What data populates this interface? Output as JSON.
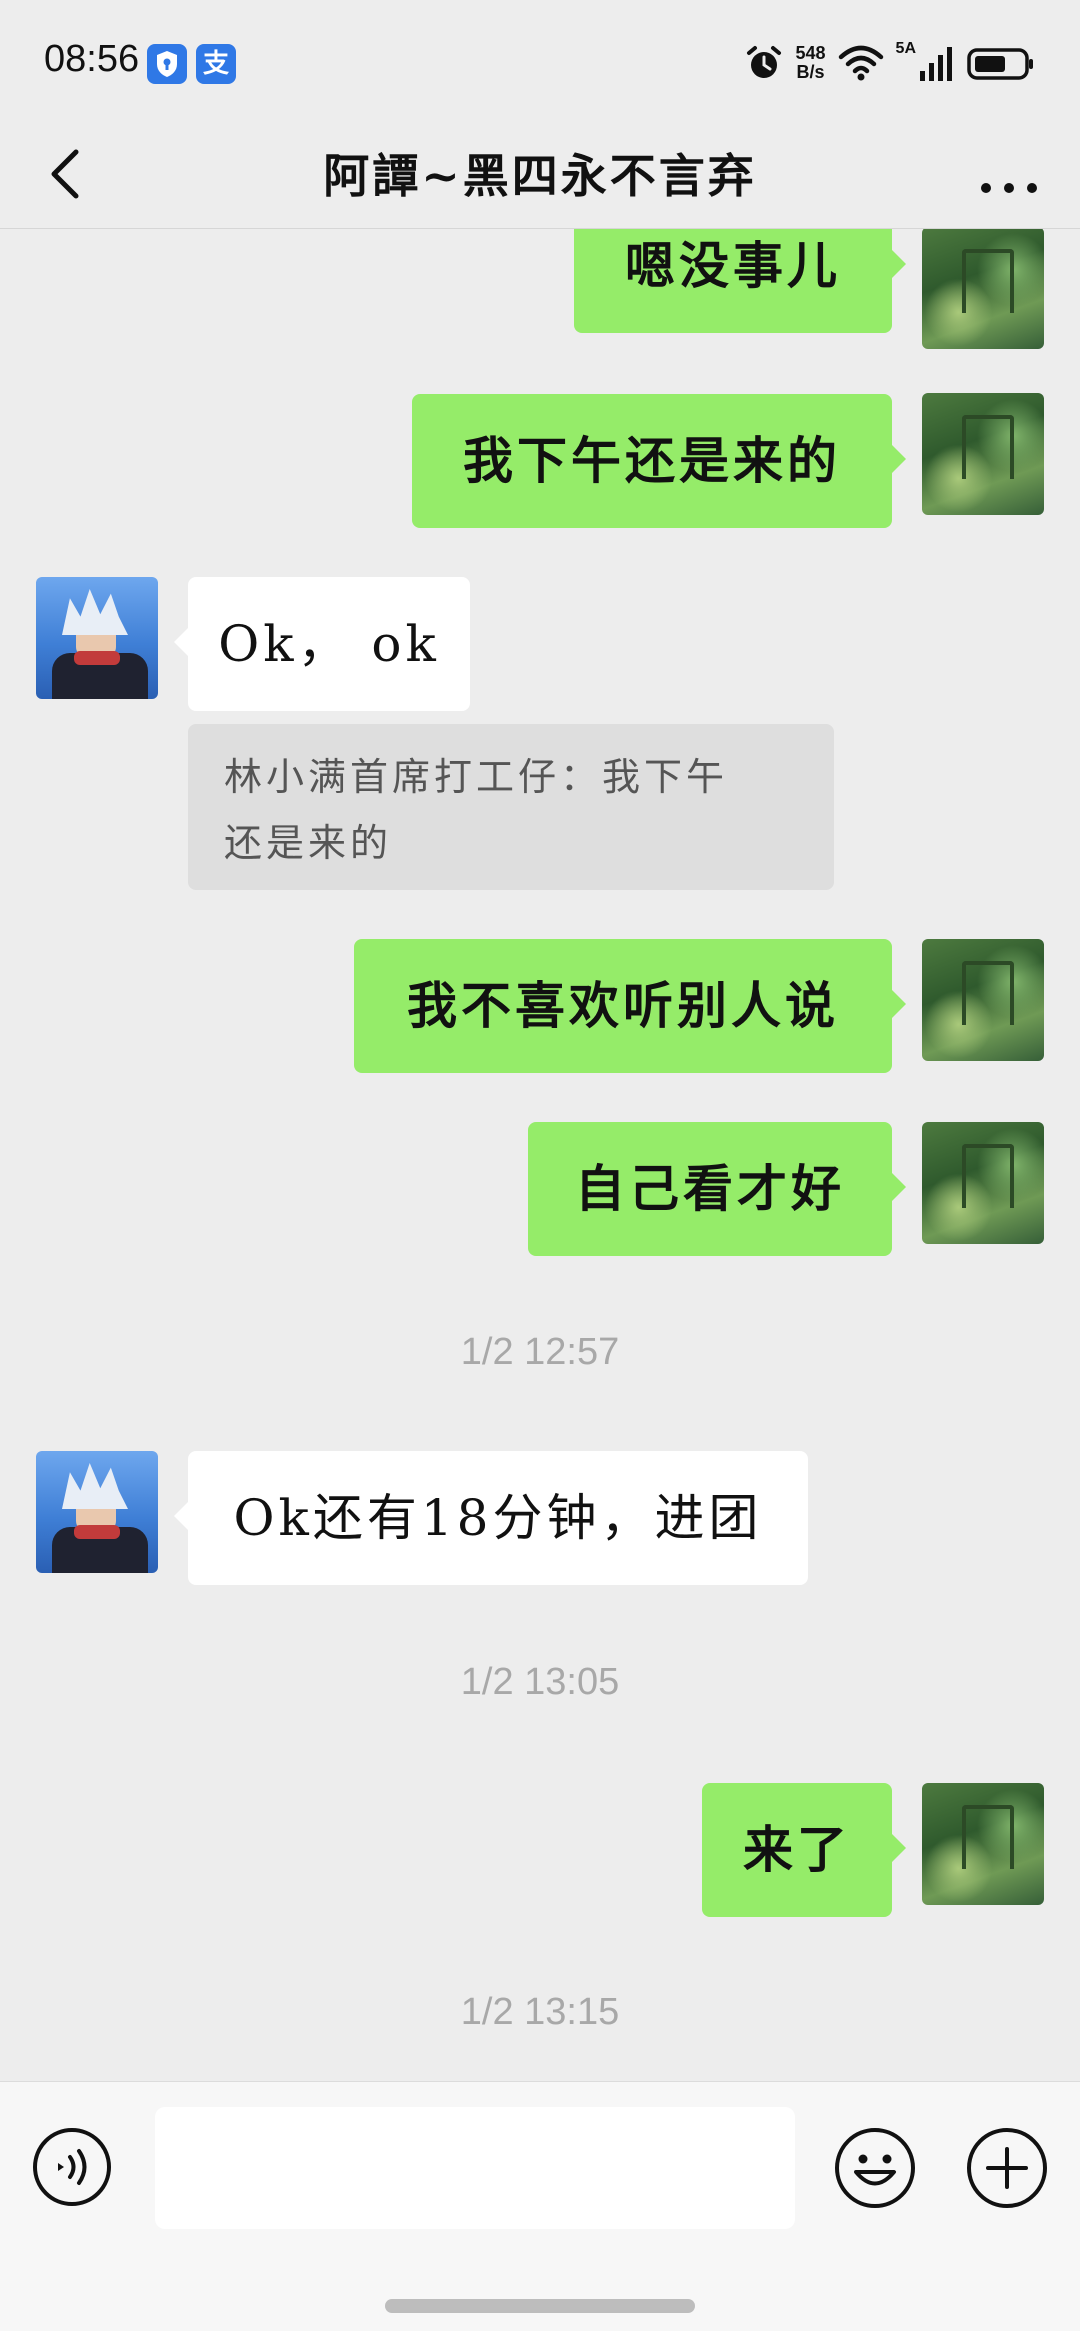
{
  "status_bar": {
    "time": "08:56",
    "app_icon_1": "shield-icon",
    "app_icon_2": "支",
    "net_speed_value": "548",
    "net_speed_unit": "B/s",
    "network_type": "5A",
    "icons": [
      "alarm-icon",
      "wifi-icon",
      "signal-icon",
      "battery-icon"
    ]
  },
  "header": {
    "title": "阿譚~黑四永不言弃",
    "back_icon": "chevron-left-icon",
    "more_icon": "more-icon"
  },
  "messages": [
    {
      "side": "self",
      "text": "嗯没事儿"
    },
    {
      "side": "self",
      "text": "我下午还是来的"
    },
    {
      "side": "other",
      "text": "Ok， ok"
    },
    {
      "quote": "林小满首席打工仔：我下午还是来的"
    },
    {
      "side": "self",
      "text": "我不喜欢听别人说"
    },
    {
      "side": "self",
      "text": "自己看才好"
    },
    {
      "timestamp": "1/2 12:57"
    },
    {
      "side": "other",
      "text": "Ok还有18分钟，进团"
    },
    {
      "timestamp": "1/2 13:05"
    },
    {
      "side": "self",
      "text": "来了"
    },
    {
      "timestamp": "1/2 13:15"
    }
  ],
  "quote_lines": [
    "林小满首席打工仔：我下午",
    "还是来的"
  ],
  "input_bar": {
    "placeholder": "",
    "voice_icon": "voice-icon",
    "emoji_icon": "emoji-icon",
    "plus_icon": "plus-icon"
  },
  "colors": {
    "background": "#ededed",
    "self_bubble": "#95ec69",
    "other_bubble": "#ffffff",
    "timestamp_text": "#a8a8a8"
  }
}
